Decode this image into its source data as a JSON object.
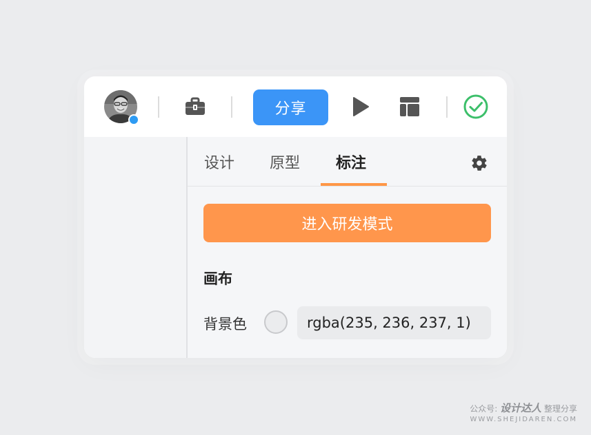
{
  "toolbar": {
    "share_label": "分享",
    "accent_color": "#3b95f7",
    "icons": [
      "avatar",
      "briefcase-icon",
      "play-icon",
      "layout-icon",
      "check-circle-icon"
    ]
  },
  "panel": {
    "tabs": [
      {
        "label": "设计",
        "active": false
      },
      {
        "label": "原型",
        "active": false
      },
      {
        "label": "标注",
        "active": true
      }
    ],
    "dev_mode_label": "进入研发模式",
    "section_title": "画布",
    "bg_color_label": "背景色",
    "bg_color_value": "rgba(235, 236, 237, 1)",
    "tab_accent_color": "#ff9646"
  },
  "watermark": {
    "prefix": "公众号:",
    "brand": "设计达人",
    "suffix": "整理分享",
    "url": "WWW.SHEJIDAREN.COM"
  }
}
